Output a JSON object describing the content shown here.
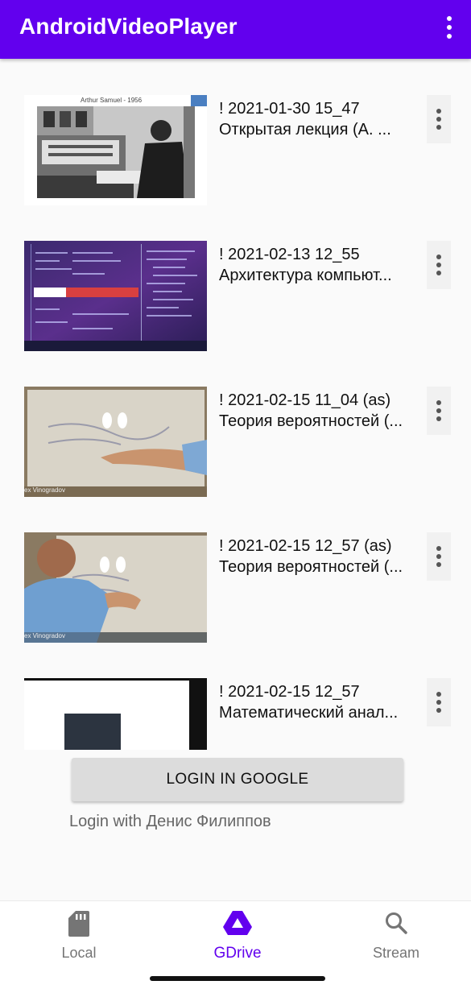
{
  "app": {
    "title": "AndroidVideoPlayer"
  },
  "videos": [
    {
      "date": "! 2021-01-30 15_47",
      "name": "Открытая лекция (А. ...",
      "thumb_caption": "Arthur Samuel - 1956"
    },
    {
      "date": "! 2021-02-13 12_55",
      "name": "Архитектура компьют..."
    },
    {
      "date": "! 2021-02-15 11_04 (as)",
      "name": "Теория вероятностей (...",
      "thumb_caption": "ex Vinogradov"
    },
    {
      "date": "! 2021-02-15 12_57 (as)",
      "name": "Теория вероятностей (...",
      "thumb_caption": "ex Vinogradov"
    },
    {
      "date": "! 2021-02-15 12_57",
      "name": "Математический анал..."
    }
  ],
  "login": {
    "button_label": "LOGIN IN GOOGLE",
    "status": "Login with Денис Филиппов"
  },
  "nav": {
    "items": [
      {
        "label": "Local",
        "icon": "sd-card-icon"
      },
      {
        "label": "GDrive",
        "icon": "google-drive-icon",
        "active": true
      },
      {
        "label": "Stream",
        "icon": "search-icon"
      }
    ]
  },
  "colors": {
    "primary": "#6200ee",
    "inactive": "#757575"
  }
}
